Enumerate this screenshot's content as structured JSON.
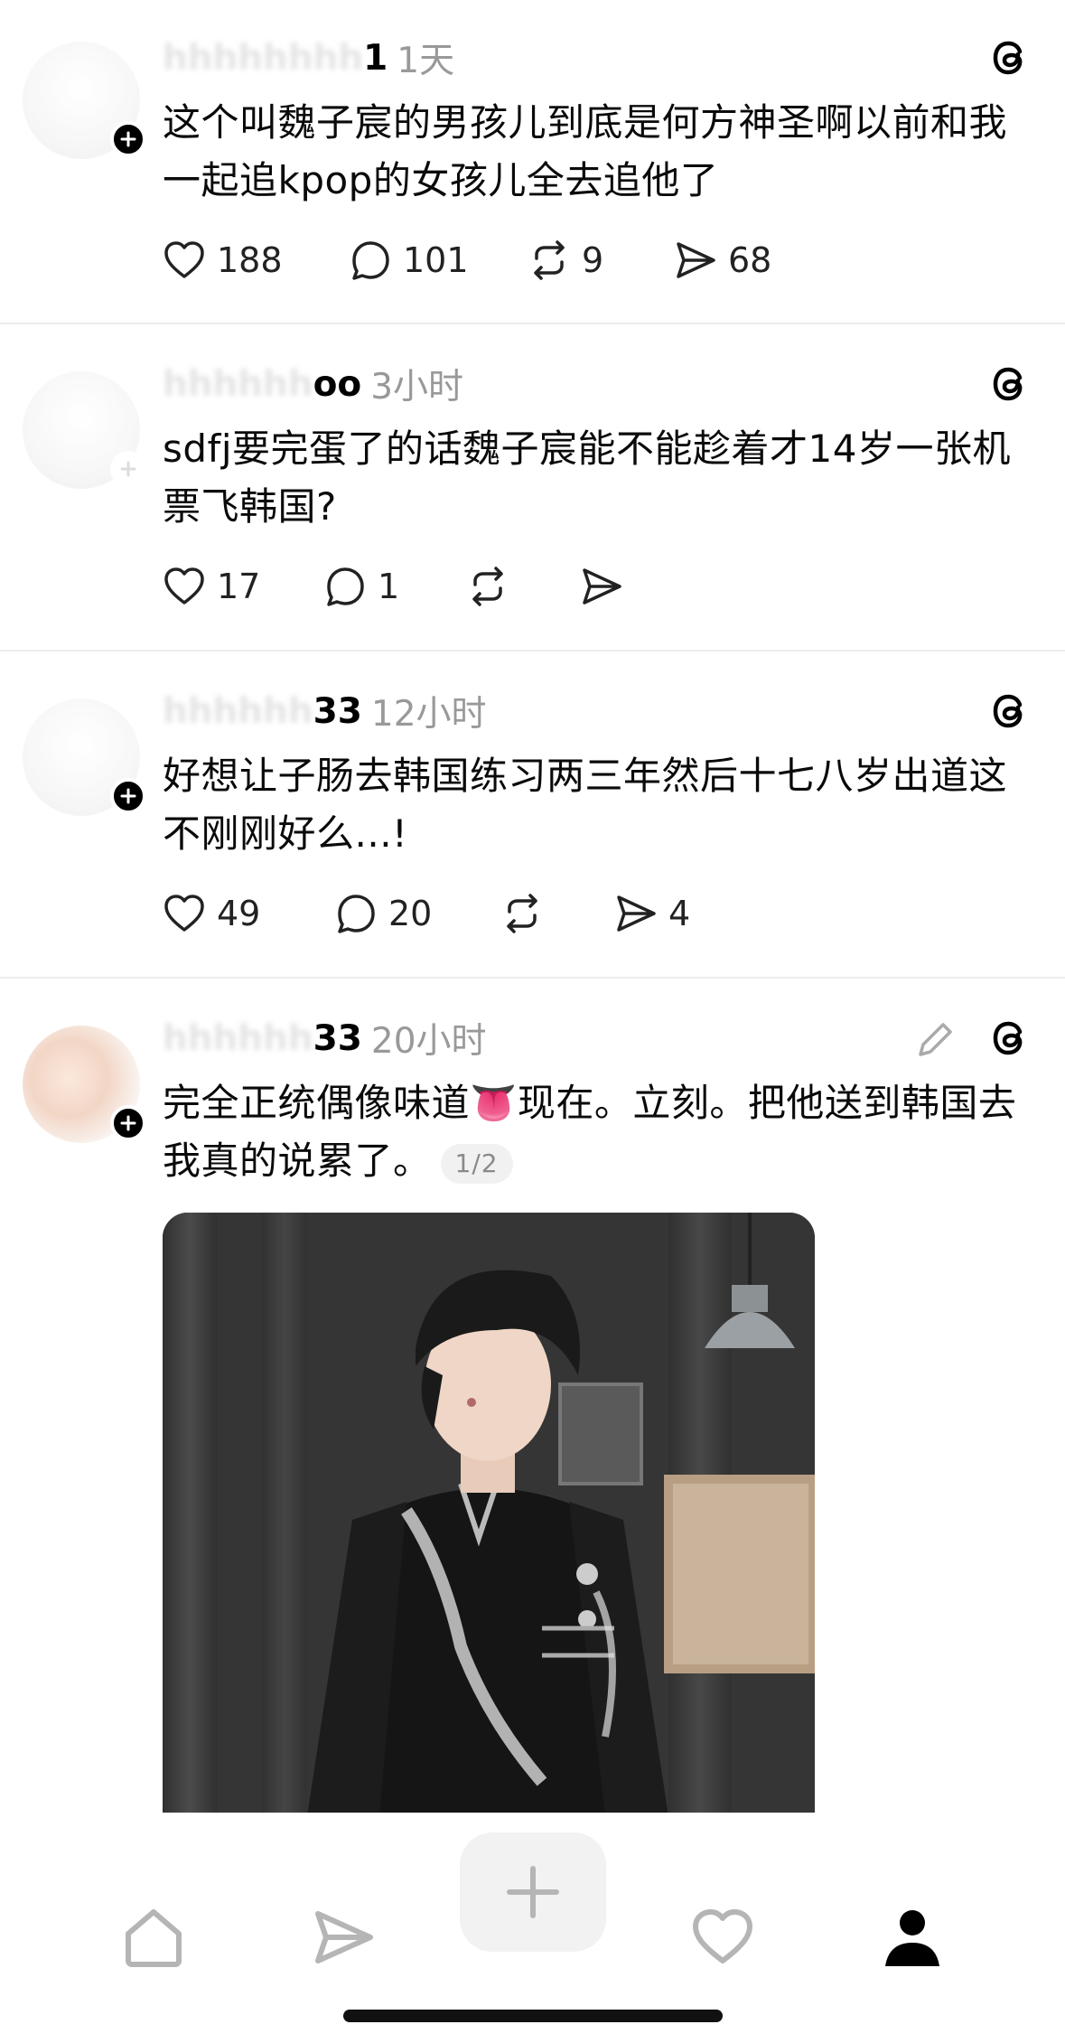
{
  "posts": [
    {
      "username_visible": "1",
      "time": "1天",
      "text": "这个叫魏子宸的男孩儿到底是何方神圣啊以前和我一起追kpop的女孩儿全去追他了",
      "likes": "188",
      "replies": "101",
      "reposts": "9",
      "shares": "68"
    },
    {
      "username_visible": "oo",
      "time": "3小时",
      "text": "sdfj要完蛋了的话魏子宸能不能趁着才14岁一张机票飞韩国?",
      "likes": "17",
      "replies": "1",
      "reposts": "",
      "shares": ""
    },
    {
      "username_visible": "33",
      "time": "12小时",
      "text": "好想让子肠去韩国练习两三年然后十七八岁出道这不刚刚好么...!",
      "likes": "49",
      "replies": "20",
      "reposts": "",
      "shares": "4"
    },
    {
      "username_visible": "33",
      "time": "20小时",
      "text_before": "完全正统偶像味道",
      "emoji": "👅",
      "text_after": "现在。立刻。把他送到韩国去我真的说累了。",
      "image_counter": "1/2"
    }
  ],
  "icons": {
    "post_header": "threads-logo-icon",
    "edit": "pencil-icon",
    "like": "heart-icon",
    "reply": "comment-icon",
    "repost": "repost-icon",
    "share": "send-icon"
  },
  "nav": [
    "home-icon",
    "send-icon",
    "plus-icon",
    "heart-icon",
    "profile-icon"
  ]
}
